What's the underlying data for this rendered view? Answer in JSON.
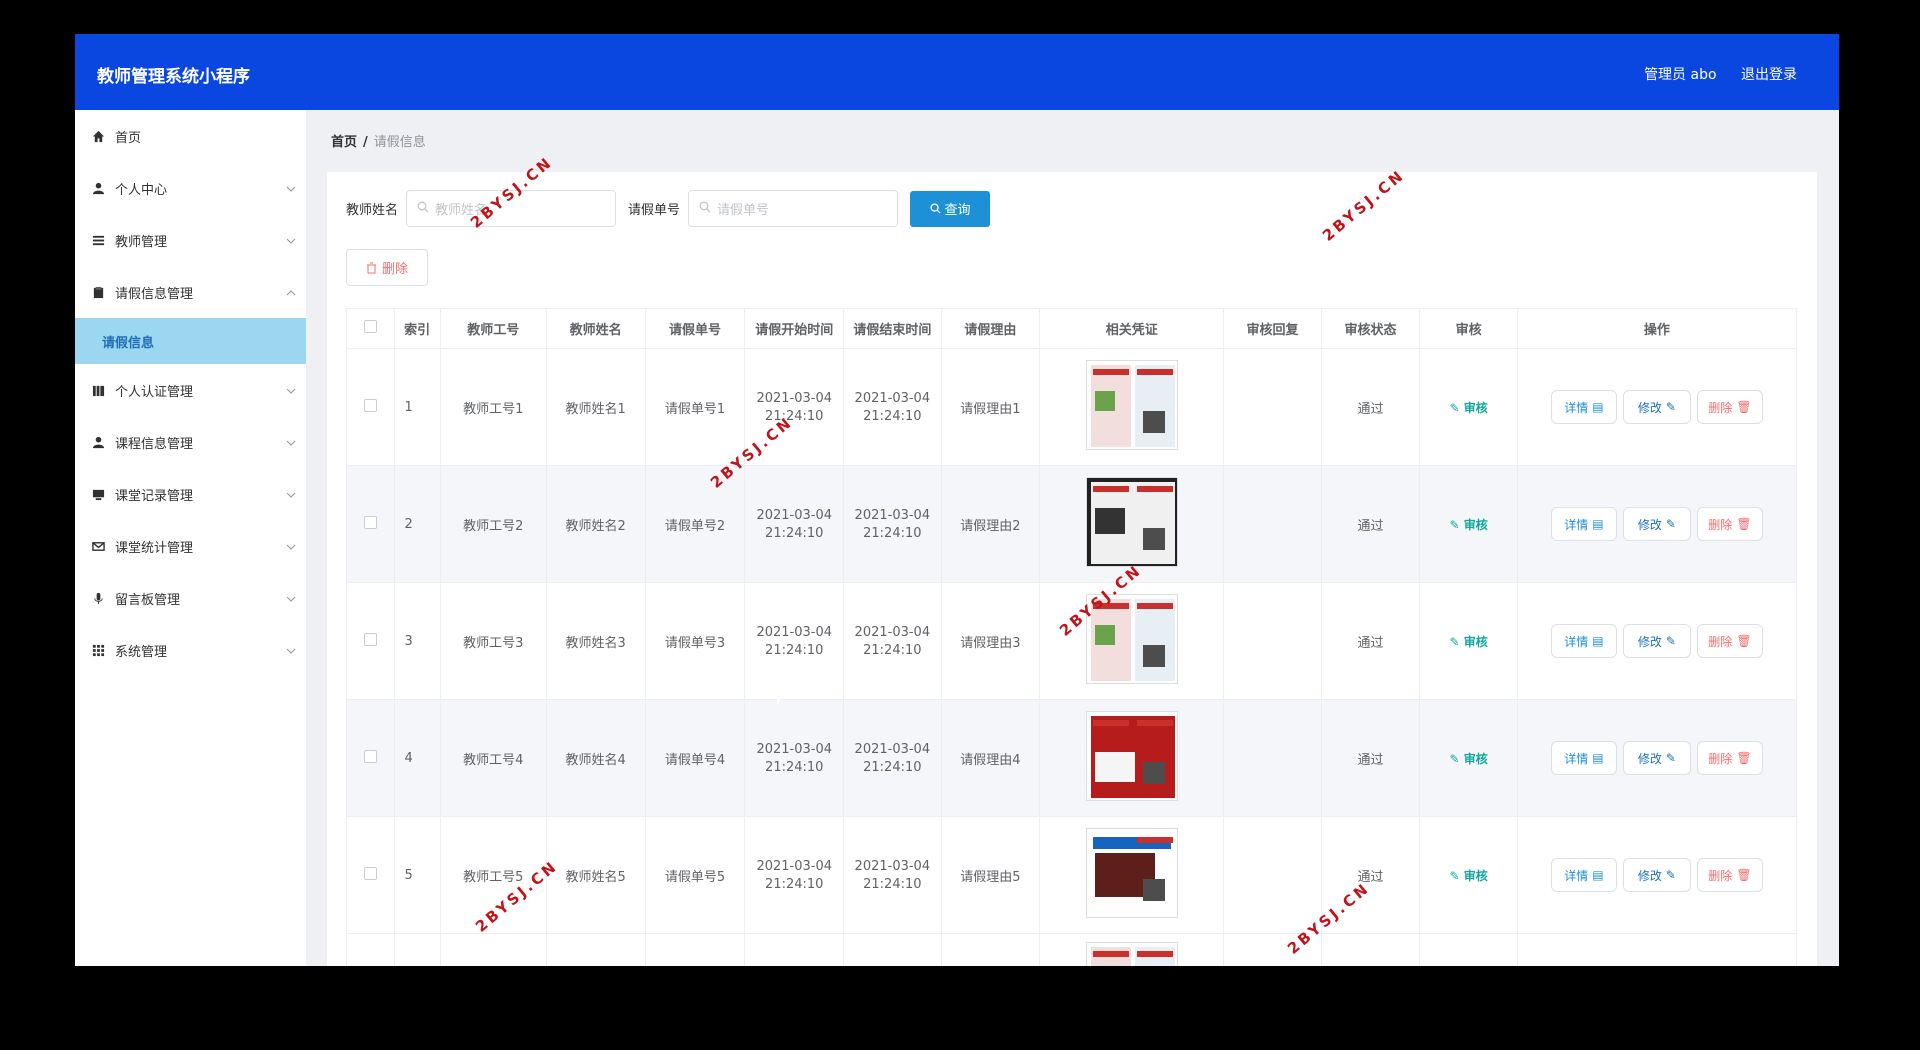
{
  "header": {
    "title": "教师管理系统小程序",
    "user": "管理员 abo",
    "logout": "退出登录"
  },
  "sidebar": {
    "items": [
      {
        "label": "首页",
        "icon": "home-icon"
      },
      {
        "label": "个人中心",
        "icon": "user-icon"
      },
      {
        "label": "教师管理",
        "icon": "list-icon"
      },
      {
        "label": "请假信息管理",
        "icon": "clipboard-icon"
      },
      {
        "label": "个人认证管理",
        "icon": "book-icon"
      },
      {
        "label": "课程信息管理",
        "icon": "person-icon"
      },
      {
        "label": "课堂记录管理",
        "icon": "monitor-icon"
      },
      {
        "label": "课堂统计管理",
        "icon": "mail-icon"
      },
      {
        "label": "留言板管理",
        "icon": "mic-icon"
      },
      {
        "label": "系统管理",
        "icon": "grid-icon"
      }
    ],
    "sub_active": "请假信息"
  },
  "breadcrumb": {
    "home": "首页",
    "current": "请假信息"
  },
  "search": {
    "teacher_name_label": "教师姓名",
    "teacher_name_placeholder": "教师姓名",
    "leave_no_label": "请假单号",
    "leave_no_placeholder": "请假单号",
    "query_label": "查询"
  },
  "delete_button": "删除",
  "table": {
    "headers": [
      "",
      "索引",
      "教师工号",
      "教师姓名",
      "请假单号",
      "请假开始时间",
      "请假结束时间",
      "请假理由",
      "相关凭证",
      "审核回复",
      "审核状态",
      "审核",
      "操作"
    ],
    "rows": [
      {
        "index": "1",
        "teacher_no": "教师工号1",
        "teacher_name": "教师姓名1",
        "leave_no": "请假单号1",
        "start": "2021-03-04",
        "start_time": "21:24:10",
        "end": "2021-03-04",
        "end_time": "21:24:10",
        "reason": "请假理由1",
        "reply": "",
        "status": "通过"
      },
      {
        "index": "2",
        "teacher_no": "教师工号2",
        "teacher_name": "教师姓名2",
        "leave_no": "请假单号2",
        "start": "2021-03-04",
        "start_time": "21:24:10",
        "end": "2021-03-04",
        "end_time": "21:24:10",
        "reason": "请假理由2",
        "reply": "",
        "status": "通过"
      },
      {
        "index": "3",
        "teacher_no": "教师工号3",
        "teacher_name": "教师姓名3",
        "leave_no": "请假单号3",
        "start": "2021-03-04",
        "start_time": "21:24:10",
        "end": "2021-03-04",
        "end_time": "21:24:10",
        "reason": "请假理由3",
        "reply": "",
        "status": "通过"
      },
      {
        "index": "4",
        "teacher_no": "教师工号4",
        "teacher_name": "教师姓名4",
        "leave_no": "请假单号4",
        "start": "2021-03-04",
        "start_time": "21:24:10",
        "end": "2021-03-04",
        "end_time": "21:24:10",
        "reason": "请假理由4",
        "reply": "",
        "status": "通过"
      },
      {
        "index": "5",
        "teacher_no": "教师工号5",
        "teacher_name": "教师姓名5",
        "leave_no": "请假单号5",
        "start": "2021-03-04",
        "start_time": "21:24:10",
        "end": "2021-03-04",
        "end_time": "21:24:10",
        "reason": "请假理由5",
        "reply": "",
        "status": "通过"
      }
    ],
    "approve_label": "审核",
    "detail_label": "详情",
    "edit_label": "修改",
    "delete_label": "删除"
  },
  "watermark": "2BYSJ.CN",
  "colors": {
    "header": "#0a46e0",
    "active_sub": "#9bd7ef",
    "query_button": "#1e90d6",
    "danger": "#f56c6c",
    "approve": "#13a89e"
  }
}
